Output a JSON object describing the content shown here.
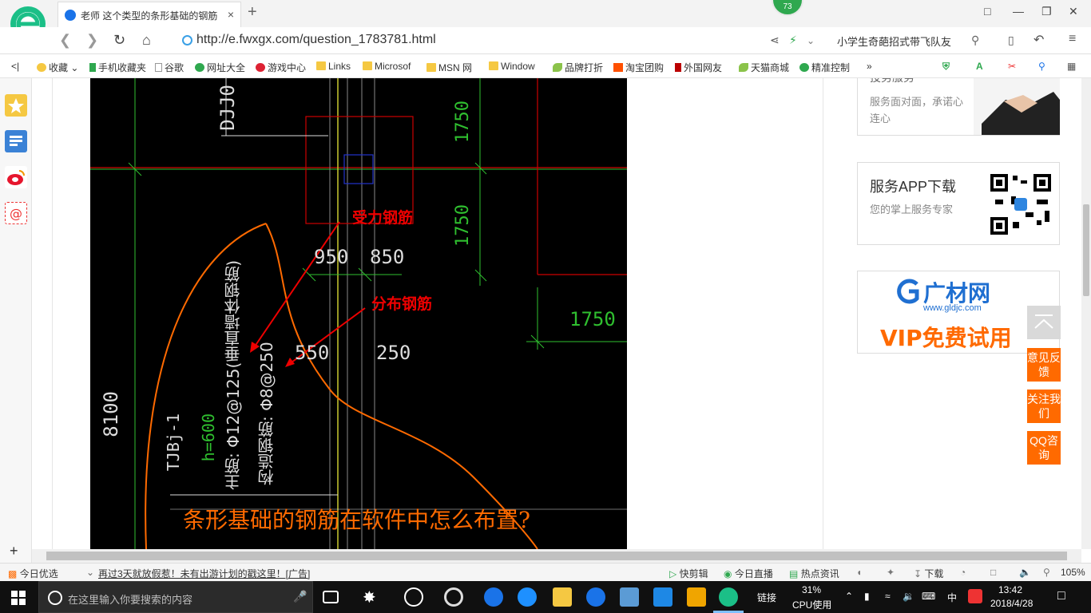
{
  "browser": {
    "tab_title": "老师 这个类型的条形基础的钢筋",
    "tab_close": "×",
    "new_tab": "+",
    "badge_count": "73",
    "url": "http://e.fwxgx.com/question_1783781.html",
    "search_text": "小学生奇葩招式带飞队友",
    "window_controls": [
      "minimize",
      "restore",
      "close"
    ]
  },
  "bookmarks": {
    "collapse": "<|",
    "items": [
      {
        "label": "收藏",
        "icon": "star-icon"
      },
      {
        "label": "手机收藏夹",
        "icon": "phone-icon"
      },
      {
        "label": "谷歌",
        "icon": "page-icon"
      },
      {
        "label": "网址大全",
        "icon": "globe-icon"
      },
      {
        "label": "游戏中心",
        "icon": "game-icon"
      },
      {
        "label": "Links",
        "icon": "folder-icon"
      },
      {
        "label": "Microsof",
        "icon": "folder-icon"
      },
      {
        "label": "MSN 网",
        "icon": "folder-icon"
      },
      {
        "label": "Window",
        "icon": "folder-icon"
      },
      {
        "label": "品牌打折",
        "icon": "leaf-icon"
      },
      {
        "label": "淘宝团购",
        "icon": "taobao-icon"
      },
      {
        "label": "外国网友",
        "icon": "flag-icon"
      },
      {
        "label": "天猫商城",
        "icon": "leaf-icon"
      },
      {
        "label": "精准控制",
        "icon": "wechat-icon"
      }
    ],
    "more": "»"
  },
  "cad": {
    "label_djj": "DJJ0",
    "dim_1750_a": "1750",
    "dim_1750_b": "1750",
    "dim_1750_c": "1750",
    "dim_950": "950",
    "dim_850": "850",
    "dim_550": "550",
    "dim_250": "250",
    "dim_8100": "8100",
    "label_tbj": "TJBj-1",
    "label_h": "h=600",
    "label_main": "主筋: Φ12@125(垂直墙体钢筋)",
    "label_dist": "构造钢筋: Φ8@250",
    "annot_force": "受力钢筋",
    "annot_dist": "分布钢筋",
    "question": "条形基础的钢筋在软件中怎么布置?"
  },
  "right_cards": {
    "service_partial_title": "投务服务",
    "service_desc": "服务面对面，承诺心连心",
    "app_title": "服务APP下载",
    "app_desc": "您的掌上服务专家",
    "ad_logo": "广材网",
    "ad_url": "www.gldjc.com",
    "ad_slogan": "VIP免费试用"
  },
  "float_buttons": [
    "意见反馈",
    "关注我们",
    "QQ咨询"
  ],
  "statusbar": {
    "today": "今日优选",
    "ad_text": "再过3天就放假惹！未有出游计划的戳这里！[广告]",
    "kuaijianji": "快剪辑",
    "live": "今日直播",
    "news": "热点资讯",
    "download": "下载",
    "zoom": "105%"
  },
  "taskbar": {
    "search_placeholder": "在这里输入你要搜索的内容",
    "link": "链接",
    "cpu_pct": "31%",
    "cpu_label": "CPU使用",
    "ime": "中",
    "time": "13:42",
    "date": "2018/4/28"
  }
}
